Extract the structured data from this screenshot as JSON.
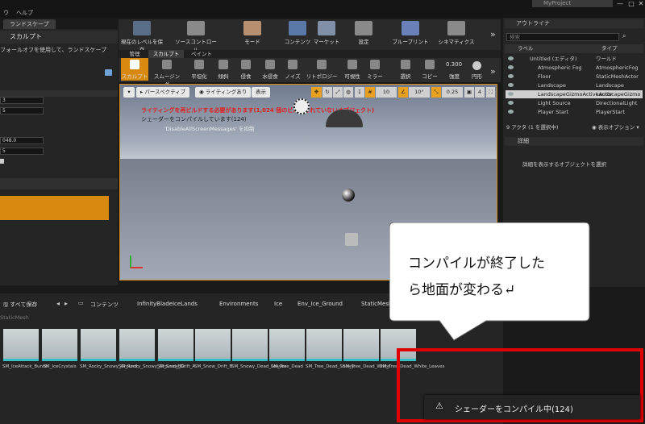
{
  "menu": {
    "item1": "ウ",
    "item2": "ヘルプ",
    "project": "MyProject"
  },
  "left": {
    "tab_title": "ランドスケープ",
    "mode_title": "スカルプト",
    "hint": "フォールオフを使用して、ランドスケープ",
    "fields": [
      "3",
      "5",
      "048.0",
      "5"
    ]
  },
  "toolbar": {
    "buttons": [
      "現在のレベルを保存",
      "ソースコントロール",
      "モード",
      "コンテンツ",
      "マーケット",
      "設定",
      "ブループリント",
      "シネマティクス"
    ],
    "tabs": [
      "管理",
      "スカルプト",
      "ペイント"
    ],
    "tools": [
      "スカルプト",
      "スムージング",
      "平坦化",
      "傾斜",
      "侵食",
      "水侵食",
      "ノイズ",
      "リトポロジー",
      "可視性",
      "ミラー",
      "選択",
      "コピー"
    ],
    "strength_value": "0.300",
    "strength_label": "強度",
    "shape_label": "円形"
  },
  "viewport": {
    "perspective": "パースペクティブ",
    "lighting": "ライティングあり",
    "show": "表示",
    "warning": "ライティングを再ビルドする必要があります(1,024 個のビルドされていないオブジェクト)",
    "shader_msg": "シェーダーをコンパイルしています(124)",
    "disable_msg": "'DisableAllScreenMessages' を抑制",
    "snap_grid": "10",
    "snap_rot": "10°",
    "snap_scale": "0.25",
    "cam_speed": "4"
  },
  "content": {
    "save_all": "すべて保存",
    "breadcrumb": [
      "コンテンツ",
      "InfinityBladeIceLands",
      "Environments",
      "Ice",
      "Env_Ice_Ground",
      "StaticMesh"
    ],
    "filter": "StaticMesh",
    "assets": [
      "SM_IceAttack_Bunch",
      "SM_IceCrystals",
      "SM_Rocky_Snowy_Ground",
      "SM_Rocky_Snowy_Ground_BG",
      "SM_Snow_Drift_A",
      "SM_Snow_Drift_B",
      "SM_Snowy_Dead_Leaves",
      "SM_Tree_Dead",
      "SM_Tree_Dead_Snowy",
      "SM_Tree_Dead_White",
      "SM_Tree_Dead_White_Leaves"
    ]
  },
  "outliner": {
    "title": "アウトライナ",
    "search_placeholder": "検索",
    "col_label": "ラベル",
    "col_type": "タイプ",
    "rows": [
      {
        "label": "Untitled (エディタ)",
        "type": "ワールド"
      },
      {
        "label": "Atmospheric Fog",
        "type": "AtmosphericFog"
      },
      {
        "label": "Floor",
        "type": "StaticMeshActor"
      },
      {
        "label": "Landscape",
        "type": "Landscape"
      },
      {
        "label": "LandscapeGizmoActiveActor",
        "type": "LandscapeGizmo"
      },
      {
        "label": "Light Source",
        "type": "DirectionalLight"
      },
      {
        "label": "Player Start",
        "type": "PlayerStart"
      }
    ],
    "count": "9 アクタ (1 を選択中)",
    "view_options": "表示オプション"
  },
  "details": {
    "title": "詳細",
    "empty_msg": "詳細を表示するオブジェクトを選択"
  },
  "callout": {
    "line1": "コンパイルが終了した",
    "line2": "ら地面が変わる↵"
  },
  "toast": {
    "text": "シェーダーをコンパイル中(124)"
  },
  "colors": {
    "accent": "#d88a10",
    "highlight": "#e8a020",
    "red_box": "#e00000"
  }
}
